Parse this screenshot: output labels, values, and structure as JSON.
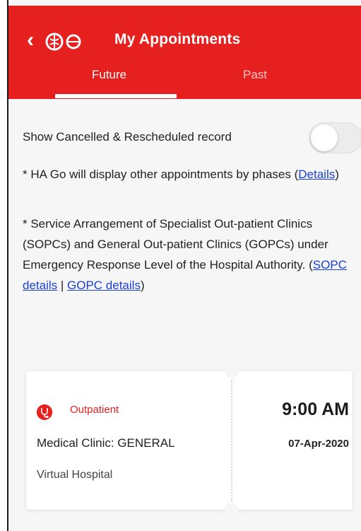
{
  "header": {
    "title": "My Appointments",
    "back_icon": "chevron-left-icon",
    "logo_icon": "ha-go-logo-icon",
    "tabs": [
      {
        "label": "Future",
        "active": true
      },
      {
        "label": "Past",
        "active": false
      }
    ]
  },
  "filters": {
    "show_cancelled_label": "Show Cancelled & Rescheduled record",
    "show_cancelled_on": false
  },
  "notes": {
    "note1_text": "* HA Go will display other appointments by phases (",
    "note1_link": "Details",
    "note1_end": ")",
    "note2_text": "* Service Arrangement of Specialist Out-patient Clinics (SOPCs) and General Out-patient Clinics (GOPCs) under Emergency Response Level of the Hospital Authority. (",
    "sopc_link": "SOPC details",
    "separator": " | ",
    "gopc_link": "GOPC details",
    "note2_end": ")"
  },
  "appointment": {
    "type_icon": "stethoscope-icon",
    "type": "Outpatient",
    "clinic": "Medical Clinic: GENERAL",
    "hospital": "Virtual Hospital",
    "time": "9:00 AM",
    "date": "07-Apr-2020"
  },
  "colors": {
    "brand_red": "#e6201f",
    "link_blue": "#1a3fd8",
    "top_accent": "#bfe58a"
  }
}
